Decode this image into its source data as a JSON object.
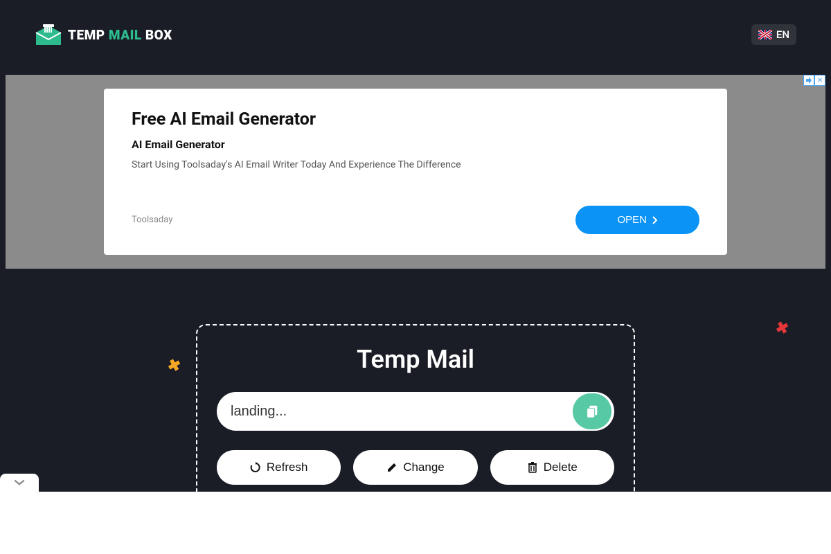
{
  "header": {
    "logo": {
      "temp": "TEMP",
      "mail": " MAIL ",
      "box": "BOX"
    },
    "language": {
      "code": "EN"
    }
  },
  "ad": {
    "title": "Free AI Email Generator",
    "subtitle": "AI Email Generator",
    "description": "Start Using Toolsaday's AI Email Writer Today And Experience The Difference",
    "brand": "Toolsaday",
    "open_label": "OPEN",
    "info_icon": "i",
    "close_icon": "✕"
  },
  "main": {
    "title": "Temp Mail",
    "email_value": "landing...",
    "actions": {
      "refresh": "Refresh",
      "change": "Change",
      "delete": "Delete"
    }
  },
  "decor": {
    "x": "✖"
  }
}
